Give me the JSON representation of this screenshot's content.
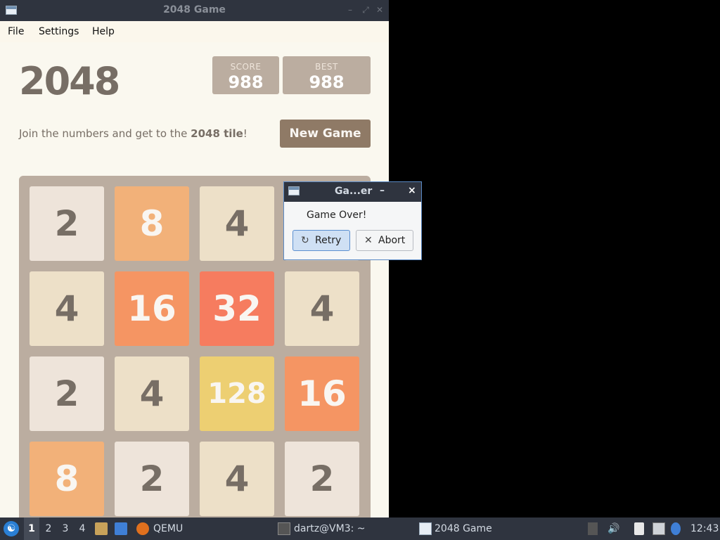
{
  "window": {
    "title": "2048 Game",
    "menu": [
      "File",
      "Settings",
      "Help"
    ]
  },
  "game": {
    "title": "2048",
    "score_label": "SCORE",
    "score": "988",
    "best_label": "BEST",
    "best": "988",
    "intro_prefix": "Join the numbers and get to the ",
    "intro_bold": "2048 tile",
    "intro_suffix": "!",
    "new_game_label": "New Game",
    "tiles": [
      [
        "2",
        "8",
        "4",
        ""
      ],
      [
        "4",
        "16",
        "32",
        "4"
      ],
      [
        "2",
        "4",
        "128",
        "16"
      ],
      [
        "8",
        "2",
        "4",
        "2"
      ]
    ]
  },
  "dialog": {
    "title": "Ga...er",
    "minimize": "–",
    "close": "×",
    "message": "Game Over!",
    "retry_label": "Retry",
    "abort_label": "Abort"
  },
  "taskbar": {
    "workspaces": [
      "1",
      "2",
      "3",
      "4"
    ],
    "qemu_label": "QEMU",
    "terminal_label": "dartz@VM3: ~",
    "game_label": "2048 Game",
    "clock": "12:43"
  },
  "colors": {
    "titlebar": "#2f343f",
    "board": "#bbada0",
    "text": "#776e65",
    "new_game_button": "#8f7a66"
  }
}
